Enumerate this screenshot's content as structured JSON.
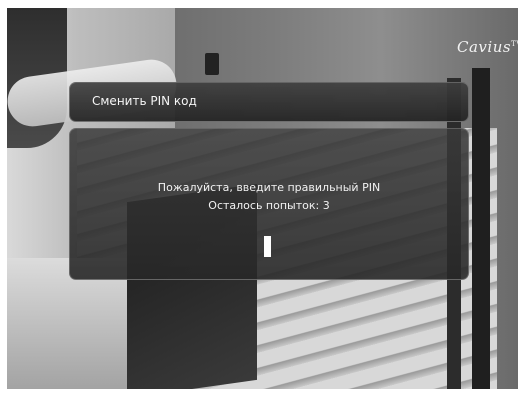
{
  "logo": {
    "text": "Cavius",
    "sub": "TV"
  },
  "title_bar": {
    "title": "Сменить PIN код"
  },
  "dialog": {
    "message": "Пожалуйста, введите правильный PIN",
    "attempts_label": "Осталось попыток: 3"
  },
  "colors": {
    "panel_bg": "#2e2e2e",
    "text": "#f2f2f2",
    "cursor": "#ffffff"
  }
}
